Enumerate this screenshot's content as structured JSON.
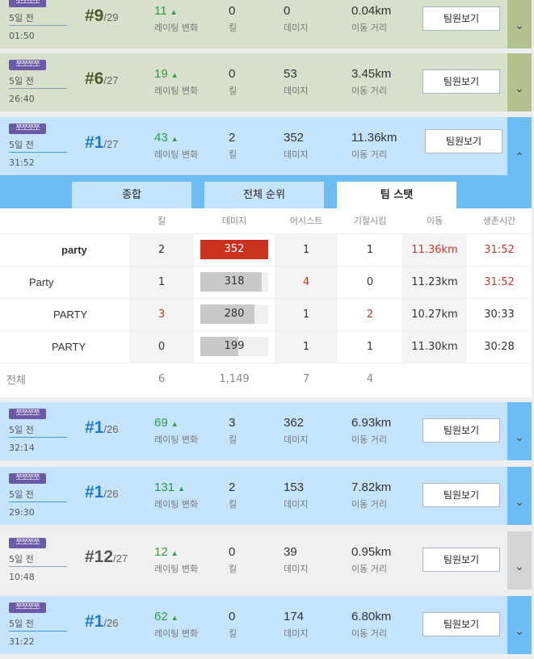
{
  "squad_badge": "쪼쪼쪼쪼",
  "labels": {
    "rating": "레이팅 변화",
    "kill": "킬",
    "damage": "데미지",
    "distance": "이동 거리",
    "team_button": "팀원보기"
  },
  "matches": [
    {
      "ago": "5일 전",
      "duration": "01:50",
      "rank": "#9",
      "total": "/29",
      "rating": "11",
      "kills": "0",
      "damage": "0",
      "distance": "0.04km",
      "color": "green"
    },
    {
      "ago": "5일 전",
      "duration": "26:40",
      "rank": "#6",
      "total": "/27",
      "rating": "19",
      "kills": "0",
      "damage": "53",
      "distance": "3.45km",
      "color": "green"
    },
    {
      "ago": "5일 전",
      "duration": "31:52",
      "rank": "#1",
      "total": "/27",
      "rating": "43",
      "kills": "2",
      "damage": "352",
      "distance": "11.36km",
      "color": "blue",
      "expanded": true
    },
    {
      "ago": "5일 전",
      "duration": "32:14",
      "rank": "#1",
      "total": "/26",
      "rating": "69",
      "kills": "3",
      "damage": "362",
      "distance": "6.93km",
      "color": "blue"
    },
    {
      "ago": "5일 전",
      "duration": "29:30",
      "rank": "#1",
      "total": "/26",
      "rating": "131",
      "kills": "2",
      "damage": "153",
      "distance": "7.82km",
      "color": "blue"
    },
    {
      "ago": "5일 전",
      "duration": "10:48",
      "rank": "#12",
      "total": "/27",
      "rating": "12",
      "kills": "0",
      "damage": "39",
      "distance": "0.95km",
      "color": "gray"
    },
    {
      "ago": "5일 전",
      "duration": "31:22",
      "rank": "#1",
      "total": "/26",
      "rating": "62",
      "kills": "0",
      "damage": "174",
      "distance": "6.80km",
      "color": "blue"
    }
  ],
  "detail": {
    "tabs": [
      "종합",
      "전체 순위",
      "팀 스탯"
    ],
    "active_tab": 2,
    "columns": [
      "킬",
      "데미지",
      "어시스트",
      "기절시킴",
      "이동",
      "생존시간"
    ],
    "rows": [
      {
        "name": "party",
        "kills": "2",
        "damage": "352",
        "damage_frac": 1.0,
        "assists": "1",
        "knocks": "1",
        "distance": "11.36km",
        "survival": "31:52"
      },
      {
        "name": "Party",
        "kills": "1",
        "damage": "318",
        "damage_frac": 0.9,
        "assists": "4",
        "knocks": "0",
        "distance": "11.23km",
        "survival": "31:52"
      },
      {
        "name": "PARTY",
        "kills": "3",
        "damage": "280",
        "damage_frac": 0.8,
        "assists": "1",
        "knocks": "2",
        "distance": "10.27km",
        "survival": "30:33"
      },
      {
        "name": "PARTY",
        "kills": "0",
        "damage": "199",
        "damage_frac": 0.56,
        "assists": "1",
        "knocks": "1",
        "distance": "11.30km",
        "survival": "30:28"
      }
    ],
    "total_label": "전체",
    "totals": {
      "kills": "6",
      "damage": "1,149",
      "assists": "7",
      "knocks": "4"
    }
  },
  "icons": {
    "rating_up": "triangle-up-icon",
    "expand": "chevron-down-icon",
    "collapse": "chevron-up-icon"
  },
  "colors": {
    "accent_blue": "#1e7bc8",
    "rating_green": "#2f9a45",
    "top_damage_red": "#c8321f"
  }
}
